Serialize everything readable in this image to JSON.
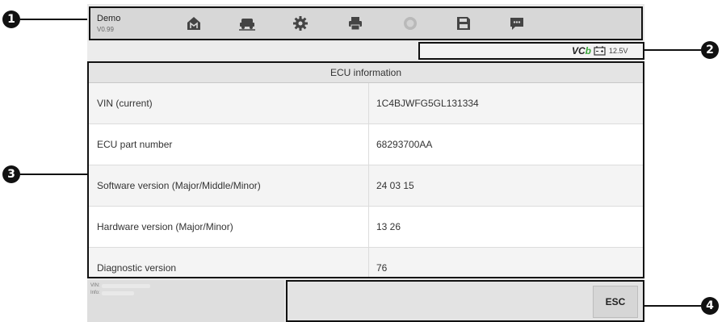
{
  "callouts": [
    "1",
    "2",
    "3",
    "4"
  ],
  "toolbar": {
    "app_title": "Demo",
    "app_version": "V0.99",
    "buttons": [
      {
        "name": "home-icon"
      },
      {
        "name": "vehicle-swap-icon"
      },
      {
        "name": "settings-icon"
      },
      {
        "name": "print-icon"
      },
      {
        "name": "help-icon"
      },
      {
        "name": "save-icon"
      },
      {
        "name": "data-logging-icon"
      }
    ]
  },
  "status": {
    "vci_label_main": "VC",
    "vci_label_b": "b",
    "voltage": "12.5V"
  },
  "ecu": {
    "title": "ECU information",
    "rows": [
      {
        "label": "VIN (current)",
        "value": "1C4BJWFG5GL131334"
      },
      {
        "label": "ECU part number",
        "value": "68293700AA"
      },
      {
        "label": "Software version (Major/Middle/Minor)",
        "value": "24 03 15"
      },
      {
        "label": "Hardware version (Major/Minor)",
        "value": "13 26"
      },
      {
        "label": "Diagnostic version",
        "value": "76"
      }
    ]
  },
  "info": {
    "vin_label": "VIN:",
    "info_label": "Info:"
  },
  "actions": {
    "esc_label": "ESC"
  },
  "colors": {
    "vci_accent": "#3aa63a",
    "callout": "#111111"
  }
}
